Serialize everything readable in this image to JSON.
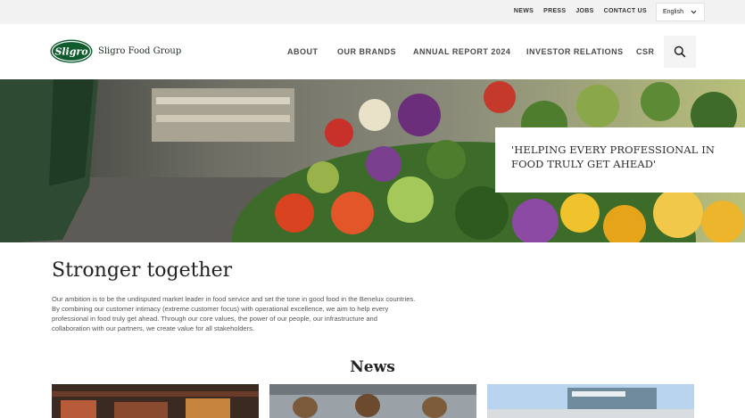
{
  "utility_nav": {
    "links": [
      "NEWS",
      "PRESS",
      "JOBS",
      "CONTACT US"
    ],
    "language": "English"
  },
  "brand": {
    "badge": "Sligro",
    "name": "Sligro Food Group"
  },
  "main_nav": {
    "items": [
      "ABOUT",
      "OUR BRANDS",
      "ANNUAL REPORT 2024",
      "INVESTOR RELATIONS",
      "CSR"
    ]
  },
  "hero": {
    "quote": "'HELPING EVERY PROFESSIONAL IN FOOD TRULY GET AHEAD'"
  },
  "intro": {
    "heading": "Stronger together",
    "body": "Our ambition is to be the undisputed market leader in food service and set the tone in good food in the Benelux countries. By combining our customer intimacy (extreme customer focus) with operational excellence, we aim to help every professional in food truly get ahead. Through our core values, the power of our people, our infrastructure and collaboration with our partners, we create value for all stakeholders."
  },
  "news": {
    "title": "News"
  },
  "colors": {
    "topbar_bg": "#f2f2f2",
    "brand_green": "#0f5b2e",
    "text_dark": "#222222"
  },
  "icons": {
    "search": "search-icon",
    "language_chevron": "chevron-down-icon"
  }
}
